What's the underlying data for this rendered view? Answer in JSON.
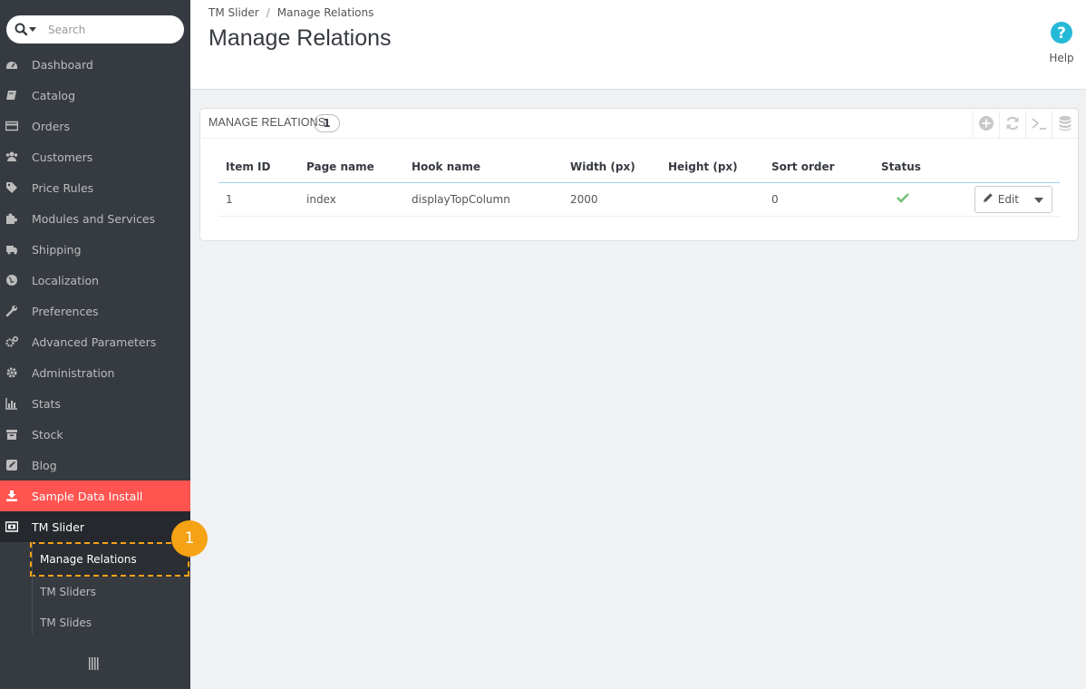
{
  "sidebar": {
    "search_placeholder": "Search",
    "items": [
      {
        "label": "Dashboard",
        "icon": "dashboard-icon"
      },
      {
        "label": "Catalog",
        "icon": "book-icon"
      },
      {
        "label": "Orders",
        "icon": "credit-card-icon"
      },
      {
        "label": "Customers",
        "icon": "users-icon"
      },
      {
        "label": "Price Rules",
        "icon": "tags-icon"
      },
      {
        "label": "Modules and Services",
        "icon": "puzzle-icon"
      },
      {
        "label": "Shipping",
        "icon": "truck-icon"
      },
      {
        "label": "Localization",
        "icon": "globe-icon"
      },
      {
        "label": "Preferences",
        "icon": "wrench-icon"
      },
      {
        "label": "Advanced Parameters",
        "icon": "cogs-icon"
      },
      {
        "label": "Administration",
        "icon": "cog-icon"
      },
      {
        "label": "Stats",
        "icon": "bar-chart-icon"
      },
      {
        "label": "Stock",
        "icon": "archive-icon"
      },
      {
        "label": "Blog",
        "icon": "edit-icon"
      },
      {
        "label": "Sample Data Install",
        "icon": "download-icon"
      },
      {
        "label": "TM Slider",
        "icon": "slider-icon"
      }
    ],
    "submenu": [
      {
        "label": "Manage Relations"
      },
      {
        "label": "TM Sliders"
      },
      {
        "label": "TM Slides"
      }
    ],
    "annotation_number": "1",
    "accent_color": "#ff5450",
    "highlight_color": "#f5a214"
  },
  "header": {
    "breadcrumb": [
      "TM Slider",
      "Manage Relations"
    ],
    "breadcrumb_sep": "/",
    "title": "Manage Relations",
    "help_label": "Help"
  },
  "panel": {
    "title": "MANAGE RELATIONS",
    "count": "1",
    "columns": [
      "Item ID",
      "Page name",
      "Hook name",
      "Width (px)",
      "Height (px)",
      "Sort order",
      "Status"
    ],
    "rows": [
      {
        "id": "1",
        "page": "index",
        "hook": "displayTopColumn",
        "width": "2000",
        "height": "",
        "sort": "0",
        "status": "enabled",
        "action": "Edit"
      }
    ]
  }
}
